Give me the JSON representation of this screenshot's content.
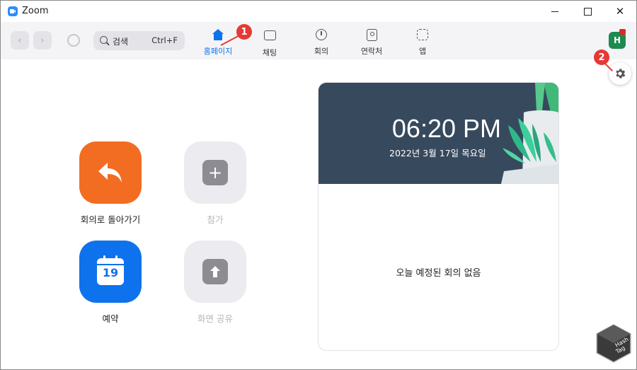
{
  "window": {
    "title": "Zoom"
  },
  "search": {
    "label": "검색",
    "shortcut": "Ctrl+F"
  },
  "tabs": [
    {
      "label": "홈페이지",
      "icon": "home-icon",
      "active": true
    },
    {
      "label": "채팅",
      "icon": "chat-icon"
    },
    {
      "label": "회의",
      "icon": "clock-icon"
    },
    {
      "label": "연락처",
      "icon": "contacts-icon"
    },
    {
      "label": "앱",
      "icon": "apps-icon"
    }
  ],
  "profile": {
    "initial": "H",
    "color": "#1e8a4f"
  },
  "annotations": {
    "step1": "1",
    "step2": "2",
    "color": "#e53935"
  },
  "actions": [
    {
      "label": "회의로 돌아가기",
      "icon": "return-arrow-icon",
      "color": "#f26d21",
      "enabled": true
    },
    {
      "label": "참가",
      "icon": "plus-icon",
      "enabled": false
    },
    {
      "label": "예약",
      "icon": "calendar-icon",
      "calendar_day": "19",
      "color": "#0e72ed",
      "enabled": true
    },
    {
      "label": "화면 공유",
      "icon": "share-up-arrow-icon",
      "enabled": false
    }
  ],
  "calendar_card": {
    "time": "06:20 PM",
    "date": "2022년 3월 17일 목요일",
    "empty_message": "오늘 예정된 회의 없음"
  },
  "watermark": {
    "text": "Hash Tag"
  }
}
